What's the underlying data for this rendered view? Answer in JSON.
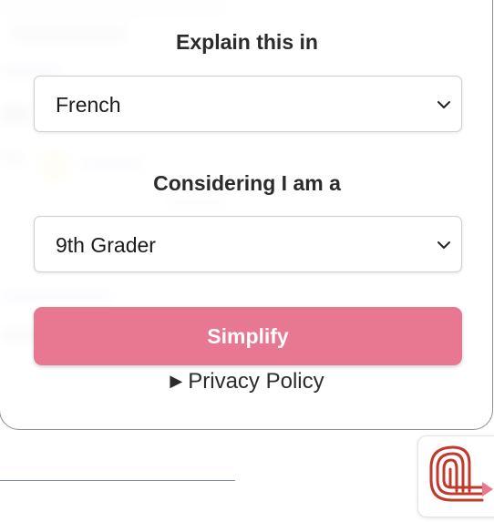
{
  "form": {
    "language_label": "Explain this in",
    "language_value": "French",
    "level_label": "Considering I am a",
    "level_value": "9th Grader",
    "submit_label": "Simplify",
    "privacy_label": "Privacy Policy"
  },
  "icons": {
    "dropdown": "chevron-down-icon",
    "disclosure": "triangle-right-icon",
    "extension": "maze-logo-icon"
  },
  "colors": {
    "accent": "#e87791",
    "logo": "#c0392b",
    "logo_accent": "#e87791"
  }
}
